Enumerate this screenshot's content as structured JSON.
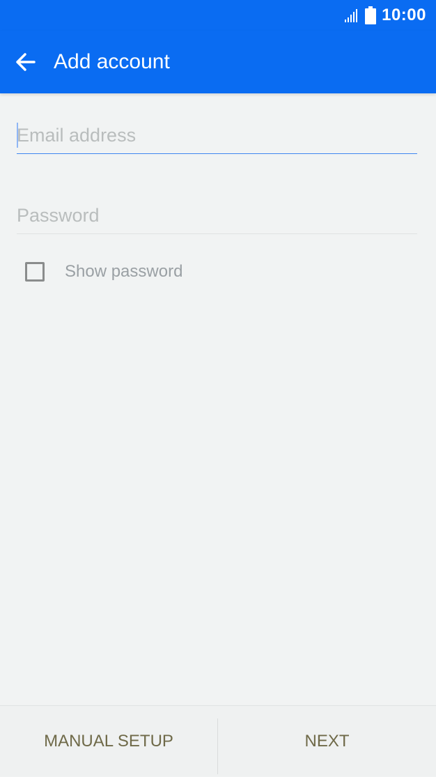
{
  "status_bar": {
    "time": "10:00",
    "icons": [
      "signal-icon",
      "battery-icon"
    ]
  },
  "app_bar": {
    "title": "Add account",
    "back_icon": "arrow-left-icon"
  },
  "form": {
    "email": {
      "placeholder": "Email address",
      "value": ""
    },
    "password": {
      "placeholder": "Password",
      "value": ""
    },
    "show_password": {
      "label": "Show password",
      "checked": false
    }
  },
  "footer": {
    "manual_setup_label": "MANUAL SETUP",
    "next_label": "NEXT"
  },
  "colors": {
    "accent": "#0a6cf2",
    "background": "#f1f3f3",
    "button_text": "#6f6a49"
  }
}
